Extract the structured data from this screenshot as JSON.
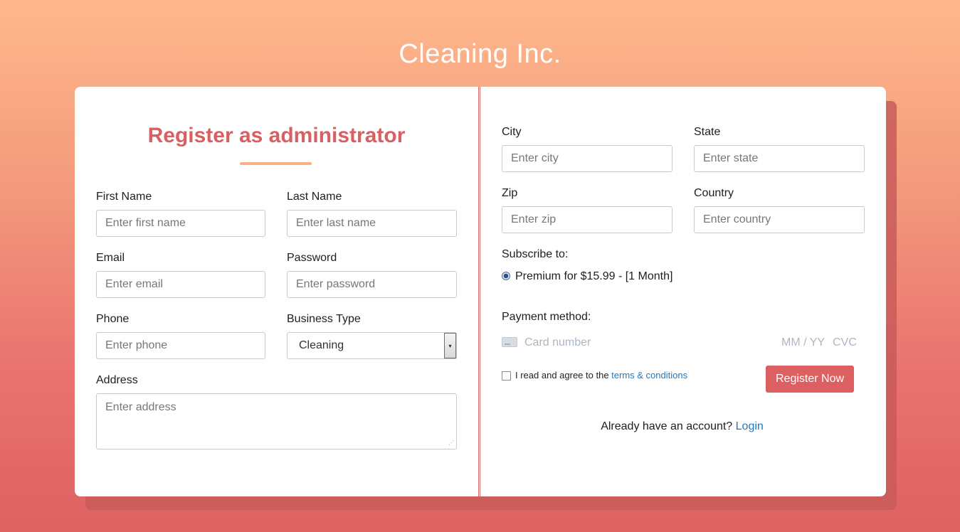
{
  "brand": {
    "title": "Cleaning Inc."
  },
  "left": {
    "heading": "Register as administrator",
    "first_name": {
      "label": "First Name",
      "placeholder": "Enter first name"
    },
    "last_name": {
      "label": "Last Name",
      "placeholder": "Enter last name"
    },
    "email": {
      "label": "Email",
      "placeholder": "Enter email"
    },
    "password": {
      "label": "Password",
      "placeholder": "Enter password"
    },
    "phone": {
      "label": "Phone",
      "placeholder": "Enter phone"
    },
    "business_type": {
      "label": "Business Type",
      "value": "Cleaning",
      "arrow": "▾"
    },
    "address": {
      "label": "Address",
      "placeholder": "Enter address",
      "grip": "⋰"
    }
  },
  "right": {
    "city": {
      "label": "City",
      "placeholder": "Enter city"
    },
    "state": {
      "label": "State",
      "placeholder": "Enter state"
    },
    "zip": {
      "label": "Zip",
      "placeholder": "Enter zip"
    },
    "country": {
      "label": "Country",
      "placeholder": "Enter country"
    },
    "subscribe": {
      "label": "Subscribe to:",
      "option": "Premium for $15.99 - [1 Month]",
      "selected": true
    },
    "payment": {
      "label": "Payment method:",
      "card_number_placeholder": "Card number",
      "expiry_placeholder": "MM / YY",
      "cvc_placeholder": "CVC"
    },
    "terms": {
      "prefix": "I read and agree to the ",
      "link": "terms & conditions",
      "checked": false
    },
    "register_button": "Register Now",
    "login": {
      "prefix": "Already have an account? ",
      "link": "Login"
    }
  },
  "colors": {
    "accent": "#dc5f61",
    "heading": "#d96062",
    "underline": "#f6b185",
    "link": "#1f78c1",
    "gradient_top": "#ffb88c",
    "gradient_bottom": "#de6262"
  }
}
